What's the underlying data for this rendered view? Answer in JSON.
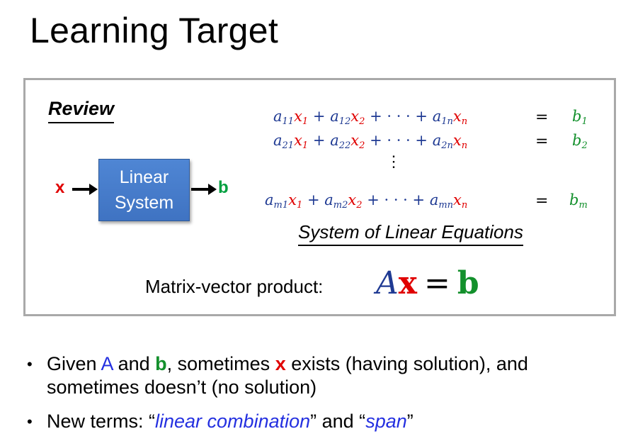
{
  "title": "Learning Target",
  "review": "Review",
  "diagram": {
    "input": "x",
    "box_line1": "Linear",
    "box_line2": "System",
    "output": "b"
  },
  "equations": {
    "rows": [
      {
        "a1": "a",
        "a1s": "11",
        "x1": "x",
        "x1s": "1",
        "a2": "a",
        "a2s": "12",
        "x2": "x",
        "x2s": "2",
        "dots": "+ · · · +",
        "an": "a",
        "ans": "1n",
        "xn": "x",
        "xns": "n",
        "eq": "=",
        "b": "b",
        "bs": "1"
      },
      {
        "a1": "a",
        "a1s": "21",
        "x1": "x",
        "x1s": "1",
        "a2": "a",
        "a2s": "22",
        "x2": "x",
        "x2s": "2",
        "dots": "+ · · · +",
        "an": "a",
        "ans": "2n",
        "xn": "x",
        "xns": "n",
        "eq": "=",
        "b": "b",
        "bs": "2"
      },
      {
        "a1": "a",
        "a1s": "m1",
        "x1": "x",
        "x1s": "1",
        "a2": "a",
        "a2s": "m2",
        "x2": "x",
        "x2s": "2",
        "dots": "+ · · · +",
        "an": "a",
        "ans": "mn",
        "xn": "x",
        "xns": "n",
        "eq": "=",
        "b": "b",
        "bs": "m"
      }
    ],
    "plus": "+",
    "vdots": "⋮",
    "caption": "System of Linear Equations"
  },
  "matrix_vector": {
    "label": "Matrix-vector product:",
    "A": "A",
    "x": "x",
    "eq": "=",
    "b": "b"
  },
  "bullets": {
    "b1": {
      "t1": "Given ",
      "A": "A",
      "t2": " and ",
      "b": "b",
      "t3": ", sometimes ",
      "x": "x",
      "t4": " exists (having solution), and sometimes doesn’t (no solution)"
    },
    "b2": {
      "t1": "New terms: “",
      "lc": "linear combination",
      "t2": "” and “",
      "span": "span",
      "t3": "”"
    },
    "symbol": "•"
  },
  "colors": {
    "red": "#e00000",
    "green": "#13902c",
    "blue": "#1f3a93",
    "box_blue": "#4a7fd0",
    "link_blue": "#2430e0"
  }
}
